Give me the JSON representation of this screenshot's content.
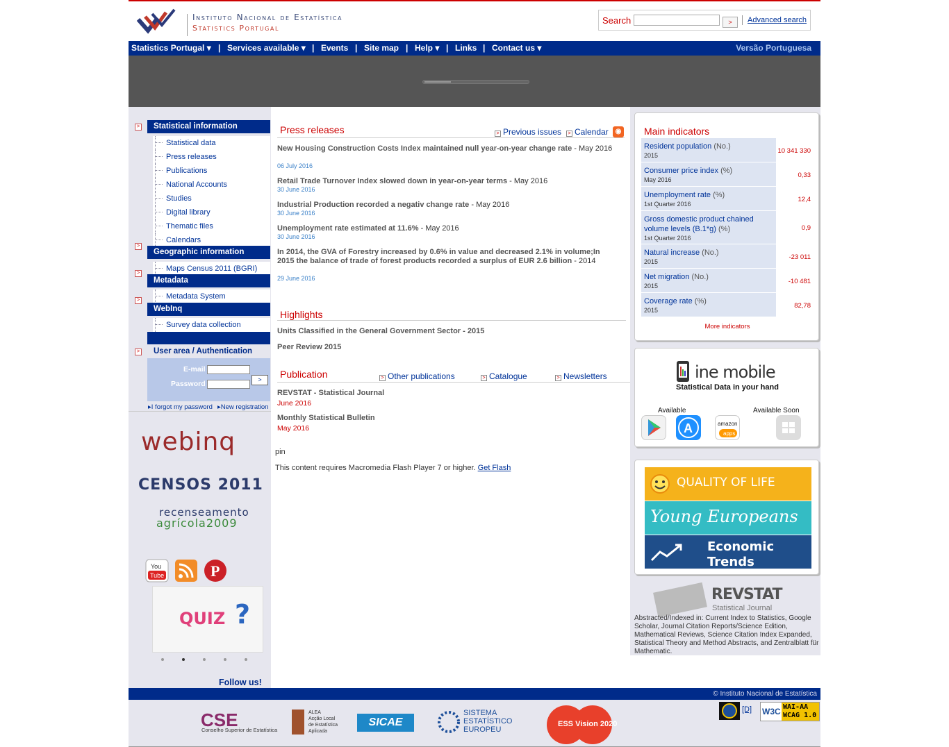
{
  "header": {
    "logo_line1": "Instituto Nacional de Estatística",
    "logo_line2": "Statistics Portugal",
    "search_label": "Search",
    "search_value": "",
    "search_go": ">",
    "advanced_search": "Advanced search"
  },
  "nav": {
    "items": [
      "Statistics Portugal ▾",
      "Services available ▾",
      "Events",
      "Site map",
      "Help ▾",
      "Links",
      "Contact us ▾"
    ],
    "separator": "|",
    "portuguese": "Versão Portuguesa"
  },
  "sidebar": {
    "sec1": "Statistical information",
    "sec1_items": [
      "Statistical data",
      "Press releases",
      "Publications",
      "National Accounts",
      "Studies",
      "Digital library",
      "Thematic files",
      "Calendars"
    ],
    "sec2": "Geographic information",
    "sec2_items": [
      "Maps Census 2011 (BGRI)"
    ],
    "sec3": "Metadata",
    "sec3_items": [
      "Metadata System"
    ],
    "sec4": "WebInq",
    "sec4_items": [
      "Survey data collection"
    ],
    "user_area": "User area / Authentication",
    "email_label": "E-mail",
    "password_label": "Password",
    "login_go": ">",
    "forgot": "I forgot my password",
    "new_reg": "New registration",
    "webinq_logo": "webinq",
    "censos_logo": "CENSOS 2011",
    "ra_logo_1": "recenseamento",
    "ra_logo_2": "agrícola2009",
    "quiz": "QUIZ",
    "quiz_mark": "?",
    "follow": "Follow us!"
  },
  "press": {
    "title": "Press releases",
    "previous": "Previous issues",
    "calendar": "Calendar",
    "items": [
      {
        "title": "New Housing Construction Costs Index maintained null year-on-year change rate",
        "period": " - May 2016",
        "date": "06 July 2016"
      },
      {
        "title": "Retail Trade Turnover Index slowed down in year-on-year terms",
        "period": " - May 2016",
        "date": "30 June 2016"
      },
      {
        "title": "Industrial Production recorded a negativ change rate",
        "period": " - May 2016",
        "date": "30 June 2016"
      },
      {
        "title": "Unemployment rate estimated at 11.6%",
        "period": " - May 2016",
        "date": "30 June 2016"
      },
      {
        "title": "In 2014, the GVA of Forestry increased by 0.6% in value and decreased 2.1% in volume;In 2015 the balance of trade of forest products recorded a surplus of EUR 2.6 billion",
        "period": " - 2014",
        "date": "29 June 2016"
      }
    ]
  },
  "highlights": {
    "title": "Highlights",
    "items": [
      "Units Classified in the General Government Sector - 2015",
      "Peer Review 2015"
    ]
  },
  "publication": {
    "title": "Publication",
    "other": "Other publications",
    "catalogue": "Catalogue",
    "newsletters": "Newsletters",
    "items": [
      {
        "title": "REVSTAT - Statistical Journal",
        "date": "June 2016"
      },
      {
        "title": "Monthly Statistical Bulletin",
        "date": "May 2016"
      }
    ],
    "pin": "pin",
    "flash_text": "This content requires Macromedia Flash Player 7 or higher. ",
    "flash_link": "Get Flash"
  },
  "indicators": {
    "title": "Main indicators",
    "rows": [
      {
        "name": "Resident population",
        "unit": "(No.)",
        "period": "2015",
        "value": "10 341 330"
      },
      {
        "name": "Consumer price index",
        "unit": "(%)",
        "period": "May 2016",
        "value": "0,33"
      },
      {
        "name": "Unemployment rate",
        "unit": "(%)",
        "period": "1st Quarter 2016",
        "value": "12,4"
      },
      {
        "name": "Gross domestic product chained volume levels (B.1*g)",
        "unit": "(%)",
        "period": "1st Quarter 2016",
        "value": "0,9"
      },
      {
        "name": "Natural increase",
        "unit": "(No.)",
        "period": "2015",
        "value": "-23 011"
      },
      {
        "name": "Net migration",
        "unit": "(No.)",
        "period": "2015",
        "value": "-10 481"
      },
      {
        "name": "Coverage rate",
        "unit": "(%)",
        "period": "2015",
        "value": "82,78"
      }
    ],
    "more": "More indicators"
  },
  "mobile": {
    "title": "ine mobile",
    "subtitle": "Statistical Data in your hand",
    "available": "Available",
    "soon": "Available Soon",
    "amazon_1": "amazon",
    "amazon_2": "apps"
  },
  "promos": {
    "quality": "QUALITY OF LIFE",
    "young": "Young Europeans",
    "economic_1": "Economic",
    "economic_2": "Trends"
  },
  "revstat": {
    "title": "REVSTAT",
    "subtitle": "Statistical Journal",
    "text": "Abstracted/Indexed in: Current Index to Statistics, Google Scholar, Journal Citation Reports/Science Edition, Mathematical Reviews, Science Citation Index Expanded, Statistical Theory and Method Abstracts, and Zentralblatt für Mathematic."
  },
  "footer": {
    "copyright": "© Instituto Nacional de Estatística",
    "csc": "CSE",
    "csc_sub": "Conselho Superior de Estatística",
    "alea": "ALEA\nAcção Local\nde Estatística\nAplicada",
    "sicae": "SICAE",
    "sen_1": "SISTEMA",
    "sen_2": "ESTATÍSTICO",
    "sen_3": "EUROPEU",
    "ess": "ESS Vision 2020",
    "d_link": "[D]",
    "w3c": "W3C",
    "wai": "WAI-AA WCAG 1.0"
  },
  "colors": {
    "nav": "#002b8a",
    "accent": "#cc0000",
    "link": "#003399"
  }
}
